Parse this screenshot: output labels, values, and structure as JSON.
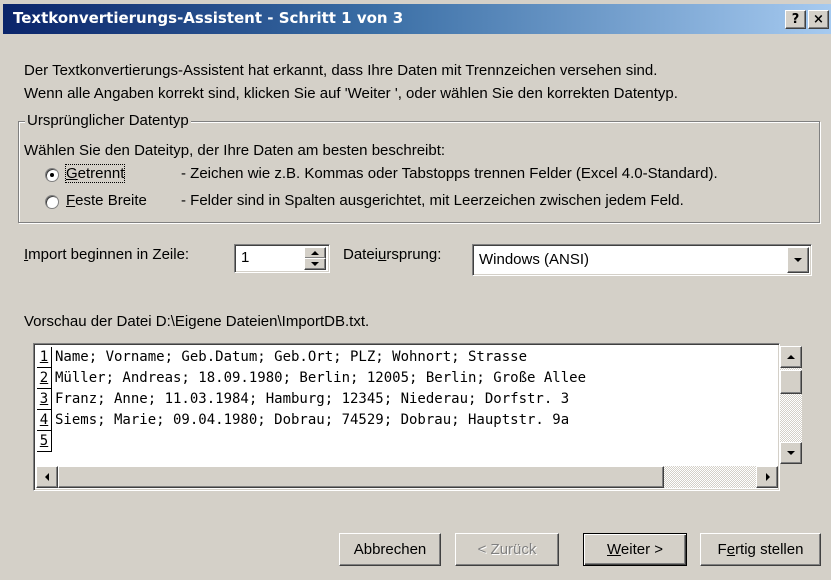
{
  "window": {
    "title": "Textkonvertierungs-Assistent - Schritt 1 von 3",
    "help_btn": "?",
    "close_btn": "×"
  },
  "intro": {
    "line1": "Der Textkonvertierungs-Assistent hat erkannt, dass Ihre Daten mit Trennzeichen versehen sind.",
    "line2": "Wenn alle Angaben korrekt sind, klicken Sie auf 'Weiter ', oder wählen Sie den korrekten Datentyp."
  },
  "datatype_group": {
    "legend": "Ursprünglicher Datentyp",
    "prompt": "Wählen Sie den Dateityp, der Ihre Daten am besten beschreibt:",
    "options": [
      {
        "accel": "G",
        "rest": "etrennt",
        "desc": "- Zeichen wie z.B. Kommas oder Tabstopps trennen Felder (Excel 4.0-Standard).",
        "selected": true
      },
      {
        "accel": "F",
        "rest": "este Breite",
        "desc": "- Felder sind in Spalten ausgerichtet, mit Leerzeichen zwischen jedem Feld.",
        "selected": false
      }
    ]
  },
  "import_row": {
    "label_accel": "I",
    "label_rest": "mport beginnen in Zeile:",
    "value": "1"
  },
  "origin": {
    "label_pre": "Datei",
    "label_accel": "u",
    "label_post": "rsprung:",
    "value": "Windows (ANSI)"
  },
  "preview": {
    "label": "Vorschau der Datei D:\\Eigene Dateien\\ImportDB.txt.",
    "lines": [
      {
        "num": "1",
        "text": "Name; Vorname; Geb.Datum; Geb.Ort; PLZ; Wohnort; Strasse"
      },
      {
        "num": "2",
        "text": "Müller; Andreas; 18.09.1980; Berlin; 12005; Berlin; Große Allee"
      },
      {
        "num": "3",
        "text": "Franz; Anne; 11.03.1984; Hamburg; 12345; Niederau; Dorfstr. 3"
      },
      {
        "num": "4",
        "text": "Siems; Marie; 09.04.1980; Dobrau; 74529; Dobrau; Hauptstr. 9a"
      },
      {
        "num": "5",
        "text": ""
      }
    ]
  },
  "buttons": {
    "cancel": "Abbrechen",
    "back": "< Zurück",
    "next_accel": "W",
    "next_rest": "eiter >",
    "finish_pre": "F",
    "finish_accel": "e",
    "finish_post": "rtig stellen"
  }
}
